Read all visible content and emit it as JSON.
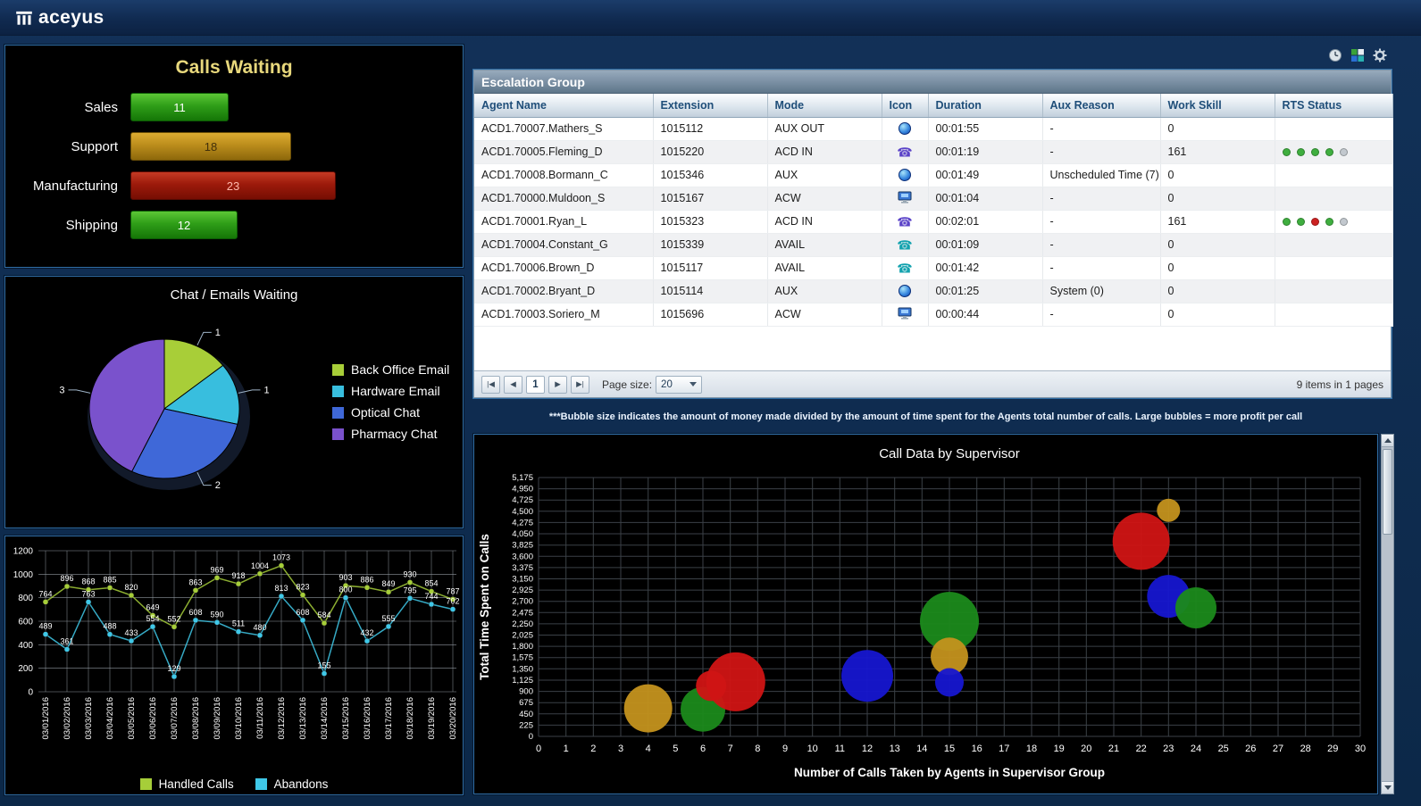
{
  "header": {
    "logo_text": "aceyus"
  },
  "toolbar": {
    "icons": [
      "clock-icon",
      "export-icon",
      "gear-icon"
    ]
  },
  "escalation": {
    "title": "Escalation Group",
    "columns": [
      "Agent Name",
      "Extension",
      "Mode",
      "Icon",
      "Duration",
      "Aux Reason",
      "Work Skill",
      "RTS Status"
    ],
    "rows": [
      {
        "agent": "ACD1.70007.Mathers_S",
        "extension": "1015112",
        "mode": "AUX OUT",
        "icon": "aux-ball-icon",
        "duration": "00:01:55",
        "aux_reason": "-",
        "work_skill": "0",
        "rts": []
      },
      {
        "agent": "ACD1.70005.Fleming_D",
        "extension": "1015220",
        "mode": "ACD IN",
        "icon": "phone-in-icon",
        "duration": "00:01:19",
        "aux_reason": "-",
        "work_skill": "161",
        "rts": [
          "green",
          "green",
          "green",
          "green",
          "gray"
        ]
      },
      {
        "agent": "ACD1.70008.Bormann_C",
        "extension": "1015346",
        "mode": "AUX",
        "icon": "aux-ball-icon",
        "duration": "00:01:49",
        "aux_reason": "Unscheduled Time (7)",
        "work_skill": "0",
        "rts": []
      },
      {
        "agent": "ACD1.70000.Muldoon_S",
        "extension": "1015167",
        "mode": "ACW",
        "icon": "monitor-icon",
        "duration": "00:01:04",
        "aux_reason": "-",
        "work_skill": "0",
        "rts": []
      },
      {
        "agent": "ACD1.70001.Ryan_L",
        "extension": "1015323",
        "mode": "ACD IN",
        "icon": "phone-in-icon",
        "duration": "00:02:01",
        "aux_reason": "-",
        "work_skill": "161",
        "rts": [
          "green",
          "green",
          "red",
          "green",
          "gray"
        ]
      },
      {
        "agent": "ACD1.70004.Constant_G",
        "extension": "1015339",
        "mode": "AVAIL",
        "icon": "phone-avail-icon",
        "duration": "00:01:09",
        "aux_reason": "-",
        "work_skill": "0",
        "rts": []
      },
      {
        "agent": "ACD1.70006.Brown_D",
        "extension": "1015117",
        "mode": "AVAIL",
        "icon": "phone-avail-icon",
        "duration": "00:01:42",
        "aux_reason": "-",
        "work_skill": "0",
        "rts": []
      },
      {
        "agent": "ACD1.70002.Bryant_D",
        "extension": "1015114",
        "mode": "AUX",
        "icon": "aux-ball-icon",
        "duration": "00:01:25",
        "aux_reason": "System (0)",
        "work_skill": "0",
        "rts": []
      },
      {
        "agent": "ACD1.70003.Soriero_M",
        "extension": "1015696",
        "mode": "ACW",
        "icon": "monitor-icon",
        "duration": "00:00:44",
        "aux_reason": "-",
        "work_skill": "0",
        "rts": []
      }
    ],
    "rts_colors": {
      "green": "#3fae3f",
      "red": "#cc2222",
      "gray": "#c2c8ce"
    },
    "pager": {
      "first_icon": "|◀",
      "prev_icon": "◀",
      "page": "1",
      "next_icon": "▶",
      "last_icon": "▶|",
      "page_size_label": "Page size:",
      "page_size": "20",
      "summary": "9 items in 1 pages"
    }
  },
  "bubble_note": "***Bubble size indicates the amount of money made divided by the amount of time spent for the Agents total number of calls. Large bubbles = more profit per call",
  "chart_data": [
    {
      "id": "calls_waiting",
      "type": "bar",
      "title": "Calls Waiting",
      "categories": [
        "Sales",
        "Support",
        "Manufacturing",
        "Shipping"
      ],
      "values": [
        11,
        18,
        23,
        12
      ],
      "colors": [
        "green",
        "gold",
        "red",
        "green"
      ],
      "palette": {
        "green": "#2f9e18",
        "gold": "#bb8d1c",
        "red": "#9c1a0b"
      },
      "xlim": [
        0,
        25
      ]
    },
    {
      "id": "chat_emails_waiting",
      "type": "pie",
      "title": "Chat / Emails Waiting",
      "labels": [
        "Back Office Email",
        "Hardware Email",
        "Optical Chat",
        "Pharmacy Chat"
      ],
      "values": [
        1,
        1,
        2,
        3
      ],
      "colors": [
        "#a8ce38",
        "#38bede",
        "#3f68d8",
        "#7a52cc"
      ],
      "legend_position": "right"
    },
    {
      "id": "handled_abandons",
      "type": "line",
      "title": "",
      "categories": [
        "03/01/2016",
        "03/02/2016",
        "03/03/2016",
        "03/04/2016",
        "03/05/2016",
        "03/06/2016",
        "03/07/2016",
        "03/08/2016",
        "03/09/2016",
        "03/10/2016",
        "03/11/2016",
        "03/12/2016",
        "03/13/2016",
        "03/14/2016",
        "03/15/2016",
        "03/16/2016",
        "03/17/2016",
        "03/18/2016",
        "03/19/2016",
        "03/20/2016"
      ],
      "series": [
        {
          "name": "Handled Calls",
          "color": "#a6ce39",
          "values": [
            764,
            896,
            868,
            885,
            820,
            649,
            552,
            863,
            969,
            918,
            1004,
            1073,
            823,
            584,
            903,
            886,
            849,
            930,
            854,
            787
          ]
        },
        {
          "name": "Abandons",
          "color": "#3fc8e8",
          "values": [
            489,
            361,
            763,
            488,
            433,
            554,
            129,
            608,
            590,
            511,
            480,
            813,
            608,
            155,
            800,
            432,
            555,
            795,
            744,
            702
          ]
        }
      ],
      "ylim": [
        0,
        1200
      ],
      "ytick_step": 200,
      "grid": true,
      "legend_position": "bottom"
    },
    {
      "id": "call_data_by_supervisor",
      "type": "scatter",
      "title": "Call Data by Supervisor",
      "xlabel": "Number of Calls Taken by Agents in Supervisor Group",
      "ylabel": "Total Time Spent on Calls",
      "xlim": [
        0,
        30
      ],
      "xtick_step": 1,
      "ylim": [
        0,
        5175
      ],
      "ytick_step": 225,
      "grid": true,
      "palette": {
        "gold": "#c4921e",
        "green": "#1b8a1b",
        "red": "#d01414",
        "blue": "#1616d0"
      },
      "bubbles": [
        {
          "x": 4,
          "y": 560,
          "r": 27,
          "color": "gold"
        },
        {
          "x": 6,
          "y": 540,
          "r": 25,
          "color": "green"
        },
        {
          "x": 6.3,
          "y": 1010,
          "r": 17,
          "color": "red"
        },
        {
          "x": 7.2,
          "y": 1090,
          "r": 33,
          "color": "red"
        },
        {
          "x": 12,
          "y": 1210,
          "r": 29,
          "color": "blue"
        },
        {
          "x": 15,
          "y": 2300,
          "r": 33,
          "color": "green"
        },
        {
          "x": 15,
          "y": 1600,
          "r": 21,
          "color": "gold"
        },
        {
          "x": 15,
          "y": 1080,
          "r": 16,
          "color": "blue"
        },
        {
          "x": 22,
          "y": 3900,
          "r": 32,
          "color": "red"
        },
        {
          "x": 23,
          "y": 4520,
          "r": 13,
          "color": "gold"
        },
        {
          "x": 23,
          "y": 2800,
          "r": 24,
          "color": "blue"
        },
        {
          "x": 24,
          "y": 2570,
          "r": 23,
          "color": "green"
        }
      ]
    }
  ]
}
